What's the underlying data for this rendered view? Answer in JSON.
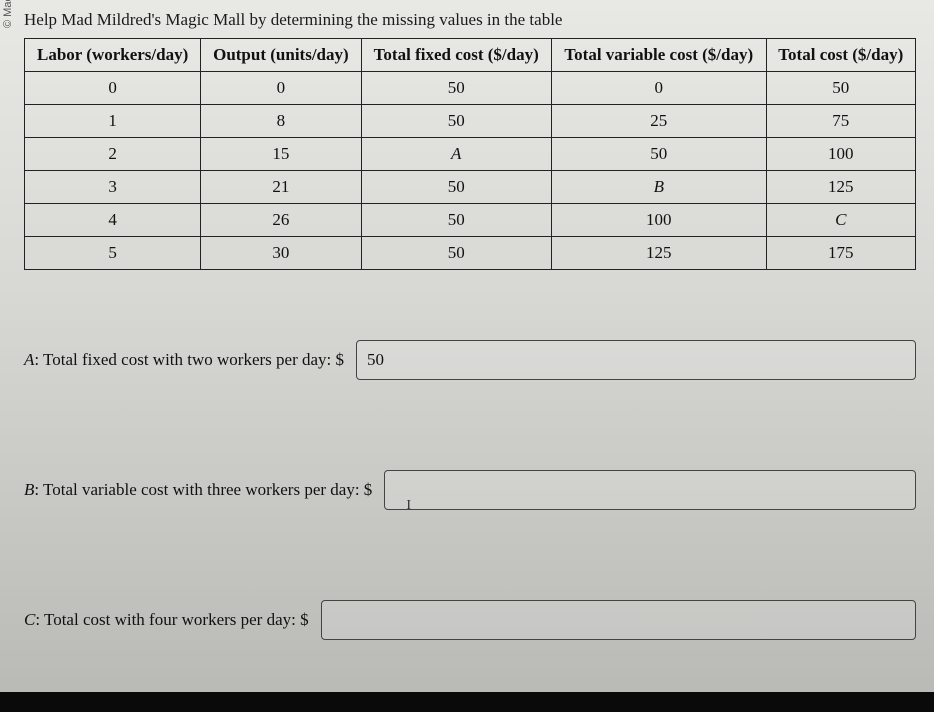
{
  "sidebar": {
    "copyright": "© Macmillan"
  },
  "instruction": "Help Mad Mildred's Magic Mall by determining the missing values in the table",
  "table": {
    "headers": [
      "Labor (workers/day)",
      "Output (units/day)",
      "Total fixed cost ($/day)",
      "Total variable cost ($/day)",
      "Total cost ($/day)"
    ],
    "rows": [
      [
        "0",
        "0",
        "50",
        "0",
        "50"
      ],
      [
        "1",
        "8",
        "50",
        "25",
        "75"
      ],
      [
        "2",
        "15",
        "A",
        "50",
        "100"
      ],
      [
        "3",
        "21",
        "50",
        "B",
        "125"
      ],
      [
        "4",
        "26",
        "50",
        "100",
        "C"
      ],
      [
        "5",
        "30",
        "50",
        "125",
        "175"
      ]
    ]
  },
  "questions": {
    "a": {
      "letter": "A",
      "text": ": Total fixed cost with two workers per day: $",
      "value": "50"
    },
    "b": {
      "letter": "B",
      "text": ": Total variable cost with three workers per day: $",
      "value": "",
      "cursor": "I"
    },
    "c": {
      "letter": "C",
      "text": ": Total cost with four workers per day: $",
      "value": ""
    }
  }
}
